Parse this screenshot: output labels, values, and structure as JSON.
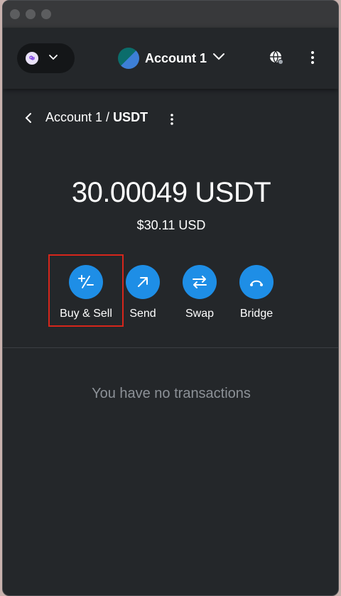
{
  "topbar": {
    "account_name": "Account 1",
    "network_icon": "polygon-icon",
    "globe_icon": "globe-connected-icon",
    "menu_icon": "kebab-menu-icon"
  },
  "asset_header": {
    "account_part": "Account 1 / ",
    "token_part": "USDT"
  },
  "balance": {
    "amount": "30.00049 USDT",
    "fiat": "$30.11 USD"
  },
  "actions": [
    {
      "label": "Buy & Sell",
      "icon": "plus-minus-icon"
    },
    {
      "label": "Send",
      "icon": "arrow-up-right-icon"
    },
    {
      "label": "Swap",
      "icon": "swap-arrows-icon"
    },
    {
      "label": "Bridge",
      "icon": "bridge-arc-icon"
    }
  ],
  "transactions": {
    "empty_text": "You have no transactions"
  },
  "colors": {
    "accent": "#1e8ee6",
    "background": "#24272a",
    "highlight": "#d6261b"
  }
}
